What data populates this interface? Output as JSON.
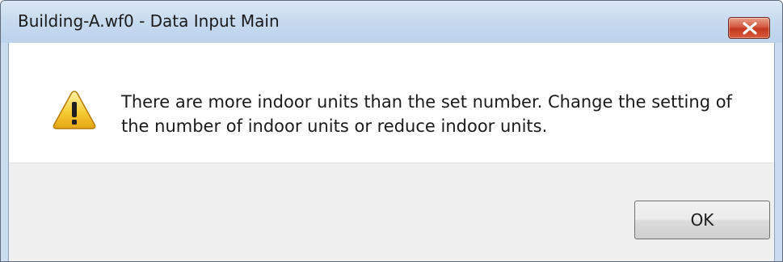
{
  "window": {
    "title": "Building-A.wf0 - Data Input Main",
    "close_icon": "close-icon"
  },
  "message": {
    "icon": "warning-icon",
    "lines": [
      "There are more indoor units than the set number. Change the setting of",
      "the number of indoor units or reduce indoor units."
    ]
  },
  "buttons": {
    "ok_label": "OK"
  },
  "colors": {
    "titlebar": "#c8dbef",
    "close_button": "#c9452b",
    "warning_triangle": "#f4c327",
    "footer": "#f0f0f0"
  }
}
